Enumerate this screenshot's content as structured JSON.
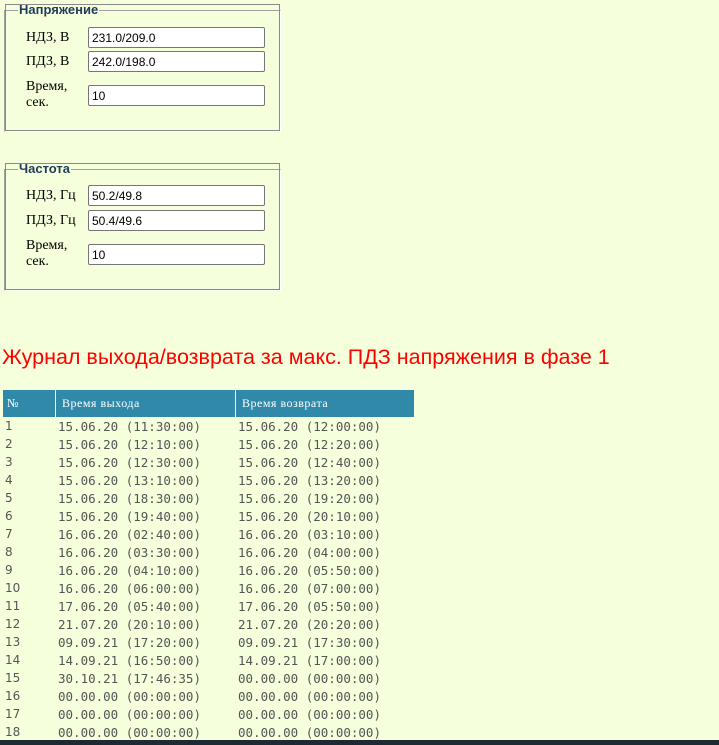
{
  "voltage": {
    "legend": "Напряжение",
    "ndz_label": "НДЗ, В",
    "ndz_value": "231.0/209.0",
    "pdz_label": "ПДЗ, В",
    "pdz_value": "242.0/198.0",
    "time_label_1": "Время,",
    "time_label_2": "сек.",
    "time_value": "10"
  },
  "frequency": {
    "legend": "Частота",
    "ndz_label": "НДЗ, Гц",
    "ndz_value": "50.2/49.8",
    "pdz_label": "ПДЗ, Гц",
    "pdz_value": "50.4/49.6",
    "time_label_1": "Время,",
    "time_label_2": "сек.",
    "time_value": "10"
  },
  "journal": {
    "title": "Журнал выхода/возврата за макс. ПДЗ напряжения в фазе 1",
    "columns": [
      "№",
      "Время выхода",
      "Время возврата"
    ],
    "rows": [
      [
        "1",
        "15.06.20 (11:30:00)",
        "15.06.20 (12:00:00)"
      ],
      [
        "2",
        "15.06.20 (12:10:00)",
        "15.06.20 (12:20:00)"
      ],
      [
        "3",
        "15.06.20 (12:30:00)",
        "15.06.20 (12:40:00)"
      ],
      [
        "4",
        "15.06.20 (13:10:00)",
        "15.06.20 (13:20:00)"
      ],
      [
        "5",
        "15.06.20 (18:30:00)",
        "15.06.20 (19:20:00)"
      ],
      [
        "6",
        "15.06.20 (19:40:00)",
        "15.06.20 (20:10:00)"
      ],
      [
        "7",
        "16.06.20 (02:40:00)",
        "16.06.20 (03:10:00)"
      ],
      [
        "8",
        "16.06.20 (03:30:00)",
        "16.06.20 (04:00:00)"
      ],
      [
        "9",
        "16.06.20 (04:10:00)",
        "16.06.20 (05:50:00)"
      ],
      [
        "10",
        "16.06.20 (06:00:00)",
        "16.06.20 (07:00:00)"
      ],
      [
        "11",
        "17.06.20 (05:40:00)",
        "17.06.20 (05:50:00)"
      ],
      [
        "12",
        "21.07.20 (20:10:00)",
        "21.07.20 (20:20:00)"
      ],
      [
        "13",
        "09.09.21 (17:20:00)",
        "09.09.21 (17:30:00)"
      ],
      [
        "14",
        "14.09.21 (16:50:00)",
        "14.09.21 (17:00:00)"
      ],
      [
        "15",
        "30.10.21 (17:46:35)",
        "00.00.00 (00:00:00)"
      ],
      [
        "16",
        "00.00.00 (00:00:00)",
        "00.00.00 (00:00:00)"
      ],
      [
        "17",
        "00.00.00 (00:00:00)",
        "00.00.00 (00:00:00)"
      ],
      [
        "18",
        "00.00.00 (00:00:00)",
        "00.00.00 (00:00:00)"
      ]
    ]
  },
  "colors": {
    "page_background": "#f5ffdc",
    "legend_text": "#1f3c5a",
    "title_red": "#ff0000",
    "table_header_bg": "#3189aa",
    "table_header_text": "#ffffff",
    "table_cell_text": "#555555"
  }
}
